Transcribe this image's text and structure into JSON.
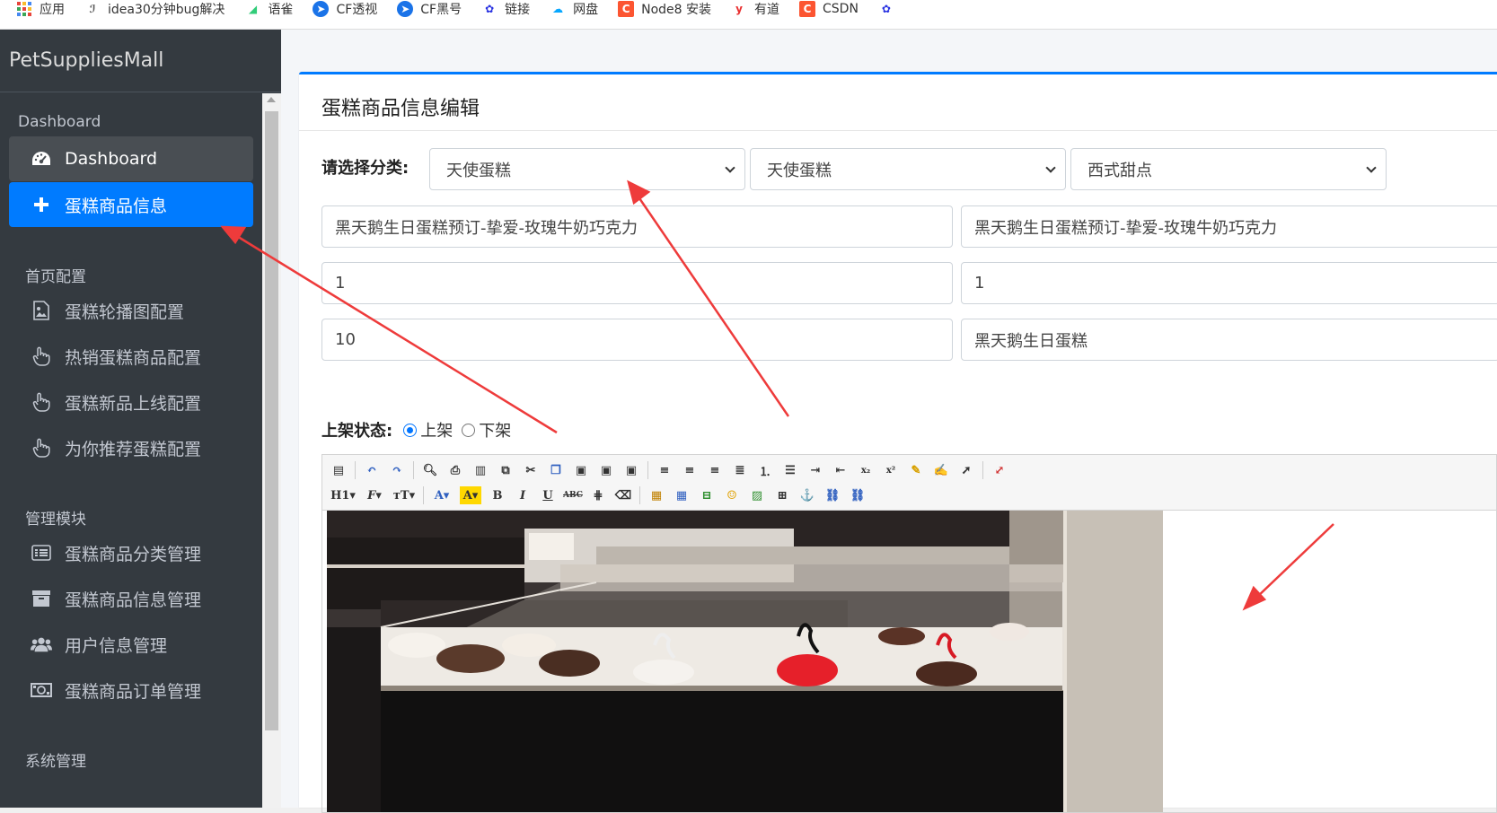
{
  "bookmarks": [
    {
      "label": "应用",
      "icon": "apps-grid-icon",
      "color": "#e8453c"
    },
    {
      "label": "idea30分钟bug解决",
      "icon": "bookmark-site-icon",
      "color": "#555555"
    },
    {
      "label": "语雀",
      "icon": "yuque-icon",
      "color": "#31cc79"
    },
    {
      "label": "CF透视",
      "icon": "cf-icon",
      "color": "#1a73e8"
    },
    {
      "label": "CF黑号",
      "icon": "cf-icon",
      "color": "#1a73e8"
    },
    {
      "label": "链接",
      "icon": "baidu-paw-icon",
      "color": "#2932e1"
    },
    {
      "label": "网盘",
      "icon": "cloud-drive-icon",
      "color": "#06a7ff"
    },
    {
      "label": "Node8 安装",
      "icon": "csdn-c-icon",
      "color": "#fc5531"
    },
    {
      "label": "有道",
      "icon": "youdao-icon",
      "color": "#e93030"
    },
    {
      "label": "CSDN",
      "icon": "csdn-c-icon",
      "color": "#fc5531"
    },
    {
      "label": "",
      "icon": "baidu-paw-icon",
      "color": "#2932e1"
    }
  ],
  "sidebar": {
    "brand": "PetSuppliesMall",
    "dashboard_header": "Dashboard",
    "dashboard_item": "Dashboard",
    "active_item": "蛋糕商品信息",
    "home_header": "首页配置",
    "home_items": [
      "蛋糕轮播图配置",
      "热销蛋糕商品配置",
      "蛋糕新品上线配置",
      "为你推荐蛋糕配置"
    ],
    "manage_header": "管理模块",
    "manage_items": [
      "蛋糕商品分类管理",
      "蛋糕商品信息管理",
      "用户信息管理",
      "蛋糕商品订单管理"
    ],
    "system_header": "系统管理"
  },
  "main": {
    "title": "蛋糕商品信息编辑",
    "category_label": "请选择分类:",
    "category_1": "天使蛋糕",
    "category_2": "天使蛋糕",
    "category_3": "西式甜点",
    "goods_name": "黑天鹅生日蛋糕预订-挚爱-玫瑰牛奶巧克力",
    "goods_intro": "黑天鹅生日蛋糕预订-挚爱-玫瑰牛奶巧克力",
    "original_price": "1",
    "selling_price": "1",
    "stock": "10",
    "tag": "黑天鹅生日蛋糕",
    "status_label": "上架状态:",
    "status_on": "上架",
    "status_off": "下架",
    "status_value": "上架"
  },
  "accent_color": "#007bff",
  "sidebar_color": "#343a40",
  "annotation_color": "#ee3b3b"
}
